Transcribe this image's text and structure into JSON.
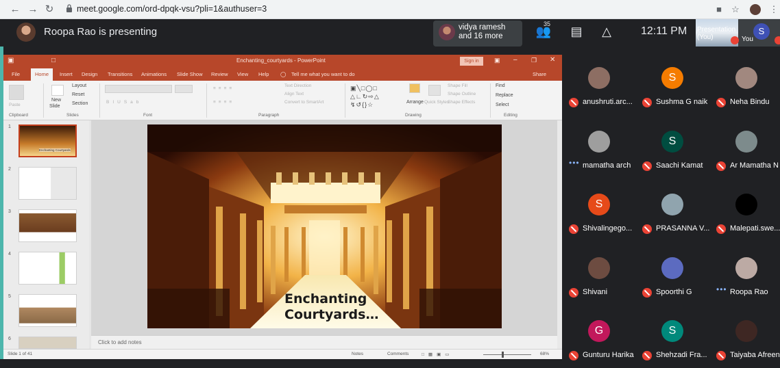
{
  "browser": {
    "url": "meet.google.com/ord-dpqk-vsu?pli=1&authuser=3"
  },
  "meet": {
    "presenting_text": "Roopa Rao is presenting",
    "others_name": "vidya ramesh",
    "others_more": "and 16 more",
    "people_count": "35",
    "clock": "12:11 PM",
    "self_label_1": "Presentation",
    "self_label_2": "(You)",
    "self_you": "You",
    "self_initial": "S"
  },
  "ppt": {
    "window_title": "Enchanting_courtyards  -  PowerPoint",
    "sign_in": "Sign in",
    "share": "Share",
    "tabs": [
      "File",
      "Home",
      "Insert",
      "Design",
      "Transitions",
      "Animations",
      "Slide Show",
      "Review",
      "View",
      "Help"
    ],
    "tell_me": "Tell me what you want to do",
    "ribbon": {
      "paste": "Paste",
      "new_slide_1": "New",
      "new_slide_2": "Slide",
      "layout": "Layout",
      "reset": "Reset",
      "section": "Section",
      "clipboard": "Clipboard",
      "slides": "Slides",
      "font": "Font",
      "paragraph": "Paragraph",
      "text_direction": "Text Direction",
      "align_text": "Align Text",
      "convert_smartart": "Convert to SmartArt",
      "drawing": "Drawing",
      "arrange": "Arrange",
      "quick_styles": "Quick Styles",
      "shape_fill": "Shape Fill",
      "shape_outline": "Shape Outline",
      "shape_effects": "Shape Effects",
      "find": "Find",
      "replace": "Replace",
      "select": "Select",
      "editing": "Editing"
    },
    "thumb_numbers": [
      "1",
      "2",
      "3",
      "4",
      "5",
      "6"
    ],
    "thumb1_caption": "Enchanting Courtyards",
    "slide_title_1": "Enchanting",
    "slide_title_2": "Courtyards…",
    "notes_placeholder": "Click to add notes",
    "status_slide": "Slide 1 of 41",
    "status_notes": "Notes",
    "status_comments": "Comments",
    "zoom": "68%"
  },
  "participants": [
    {
      "name": "anushruti.arc...",
      "initial": "",
      "color": "#8d6e63",
      "status": "muted"
    },
    {
      "name": "Sushma G naik",
      "initial": "S",
      "color": "#f57c00",
      "status": "muted"
    },
    {
      "name": "Neha Bindu",
      "initial": "",
      "color": "#a1887f",
      "status": "muted"
    },
    {
      "name": "mamatha arch",
      "initial": "",
      "color": "#9e9e9e",
      "status": "speaking"
    },
    {
      "name": "Saachi Kamat",
      "initial": "S",
      "color": "#004d40",
      "status": "muted"
    },
    {
      "name": "Ar Mamatha N",
      "initial": "",
      "color": "#7d8b8c",
      "status": "muted"
    },
    {
      "name": "Shivalingego...",
      "initial": "S",
      "color": "#e64a19",
      "status": "muted"
    },
    {
      "name": "PRASANNA V...",
      "initial": "",
      "color": "#90a4ae",
      "status": "muted"
    },
    {
      "name": "Malepati.swe...",
      "initial": "",
      "color": "#000000",
      "status": "muted"
    },
    {
      "name": "Shivani",
      "initial": "",
      "color": "#6d4c41",
      "status": "muted"
    },
    {
      "name": "Spoorthi G",
      "initial": "",
      "color": "#5c6bc0",
      "status": "muted"
    },
    {
      "name": "Roopa Rao",
      "initial": "",
      "color": "#bcaaa4",
      "status": "speaking"
    },
    {
      "name": "Gunturu Harika",
      "initial": "G",
      "color": "#c2185b",
      "status": "muted"
    },
    {
      "name": "Shehzadi Fra...",
      "initial": "S",
      "color": "#00897b",
      "status": "muted"
    },
    {
      "name": "Taiyaba Afreen",
      "initial": "",
      "color": "#3e2723",
      "status": "muted"
    }
  ]
}
